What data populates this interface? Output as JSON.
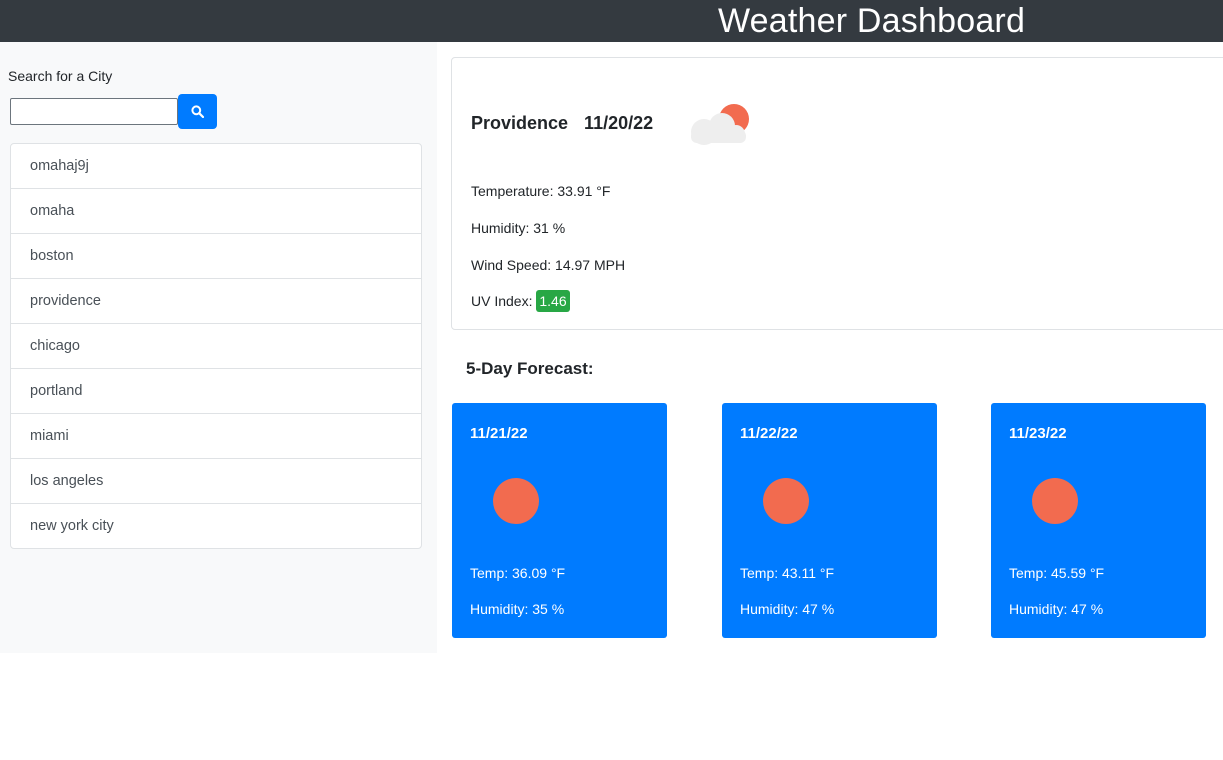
{
  "header": {
    "title": "Weather Dashboard"
  },
  "sidebar": {
    "search_label": "Search for a City",
    "search_value": "",
    "search_button_icon": "search-icon",
    "cities": [
      "omahaj9j",
      "omaha",
      "boston",
      "providence",
      "chicago",
      "portland",
      "miami",
      "los angeles",
      "new york city"
    ]
  },
  "current": {
    "city": "Providence",
    "date": "11/20/22",
    "icon": "partly-cloudy-icon",
    "temperature": "Temperature: 33.91 °F",
    "humidity": "Humidity: 31 %",
    "wind_speed": "Wind Speed: 14.97 MPH",
    "uv_label": "UV Index: ",
    "uv_value": "1.46",
    "uv_color": "#28a745"
  },
  "forecast": {
    "heading": "5-Day Forecast:",
    "days": [
      {
        "date": "11/21/22",
        "icon": "sun-icon",
        "temp": "Temp: 36.09 °F",
        "humidity": "Humidity: 35 %"
      },
      {
        "date": "11/22/22",
        "icon": "sun-icon",
        "temp": "Temp: 43.11 °F",
        "humidity": "Humidity: 47 %"
      },
      {
        "date": "11/23/22",
        "icon": "sun-icon",
        "temp": "Temp: 45.59 °F",
        "humidity": "Humidity: 47 %"
      }
    ]
  },
  "colors": {
    "header_bg": "#343a40",
    "accent_blue": "#007bff",
    "sun": "#f26b4f",
    "uv_green": "#28a745"
  }
}
